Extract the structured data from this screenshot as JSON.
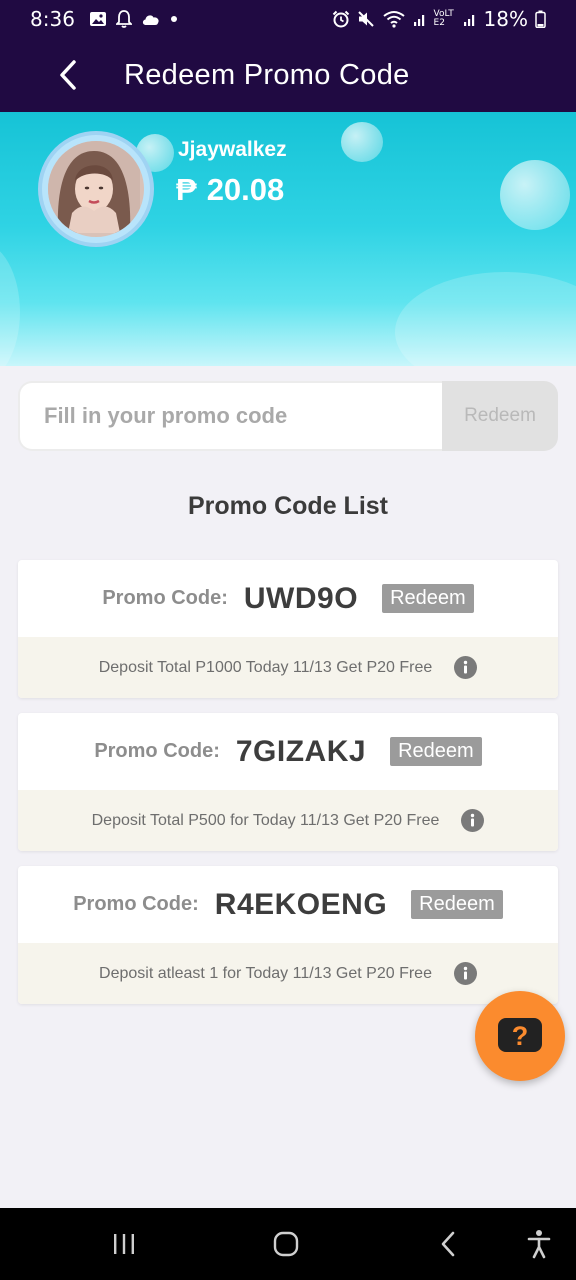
{
  "status_bar": {
    "time": "8:36",
    "battery": "18%",
    "left_icons": [
      "image-icon",
      "bell-icon",
      "cloud-icon",
      "dot-icon"
    ],
    "right_icons": [
      "alarm-icon",
      "mute-icon",
      "wifi-icon",
      "signal-icon",
      "volte-icon",
      "signal-icon",
      "battery-icon"
    ],
    "volte_label": "VoLTE2"
  },
  "header": {
    "title": "Redeem Promo Code",
    "back_icon": "chevron-left-icon"
  },
  "profile": {
    "username": "Jjaywalkez",
    "currency_symbol": "₱",
    "balance": "20.08"
  },
  "promo_input": {
    "placeholder": "Fill in your promo code",
    "value": "",
    "button_label": "Redeem"
  },
  "promo_list": {
    "title": "Promo Code List",
    "label": "Promo Code:",
    "items": [
      {
        "code": "UWD9O",
        "button_label": "Redeem",
        "description": "Deposit Total P1000 Today 11/13 Get P20 Free"
      },
      {
        "code": "7GIZAKJ",
        "button_label": "Redeem",
        "description": "Deposit Total P500 for Today 11/13 Get P20 Free"
      },
      {
        "code": "R4EKOENG",
        "button_label": "Redeem",
        "description": "Deposit atleast 1 for Today 11/13 Get P20 Free"
      }
    ]
  },
  "help_button": {
    "icon": "question-icon",
    "glyph": "?"
  },
  "nav_bar": {
    "items": [
      "recents-icon",
      "home-icon",
      "back-icon",
      "accessibility-icon"
    ]
  },
  "colors": {
    "header_bg": "#200a42",
    "hero_gradient_top": "#16c3d6",
    "fab_orange": "#fb8b2e",
    "redeem_gray": "#9b9b9b",
    "card_footer_bg": "#f6f4ec"
  }
}
